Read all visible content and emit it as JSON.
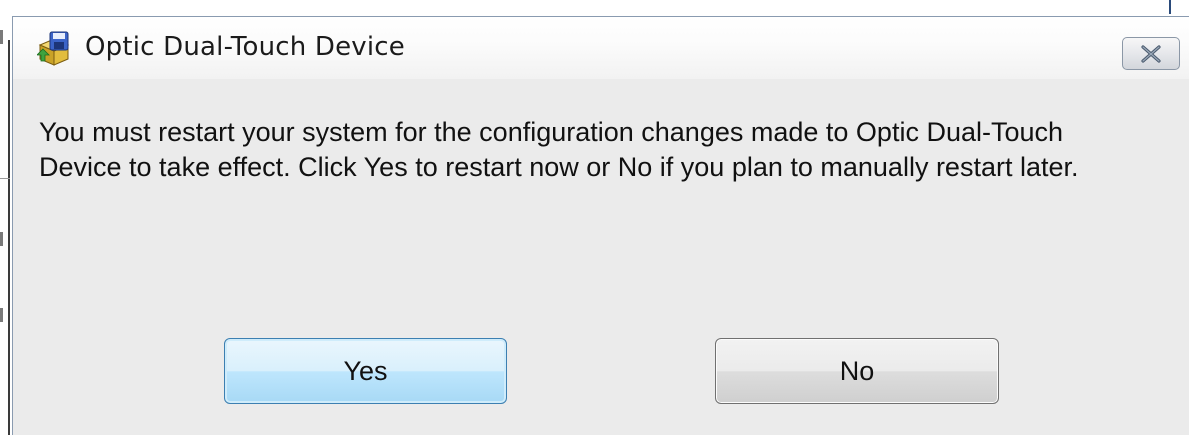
{
  "dialog": {
    "title": "Optic Dual-Touch Device",
    "icon": "installer-icon",
    "message_line1": "You must restart your system for the configuration changes made to Optic Dual-Touch",
    "message_line2": "Device to take effect. Click Yes to restart now or No if you plan to manually restart later.",
    "buttons": {
      "yes_label": "Yes",
      "no_label": "No"
    },
    "close_icon": "close-icon"
  },
  "colors": {
    "default_button": "#a7d9f5",
    "dialog_background": "#ebebeb",
    "close_button_border": "#8b97a6"
  }
}
